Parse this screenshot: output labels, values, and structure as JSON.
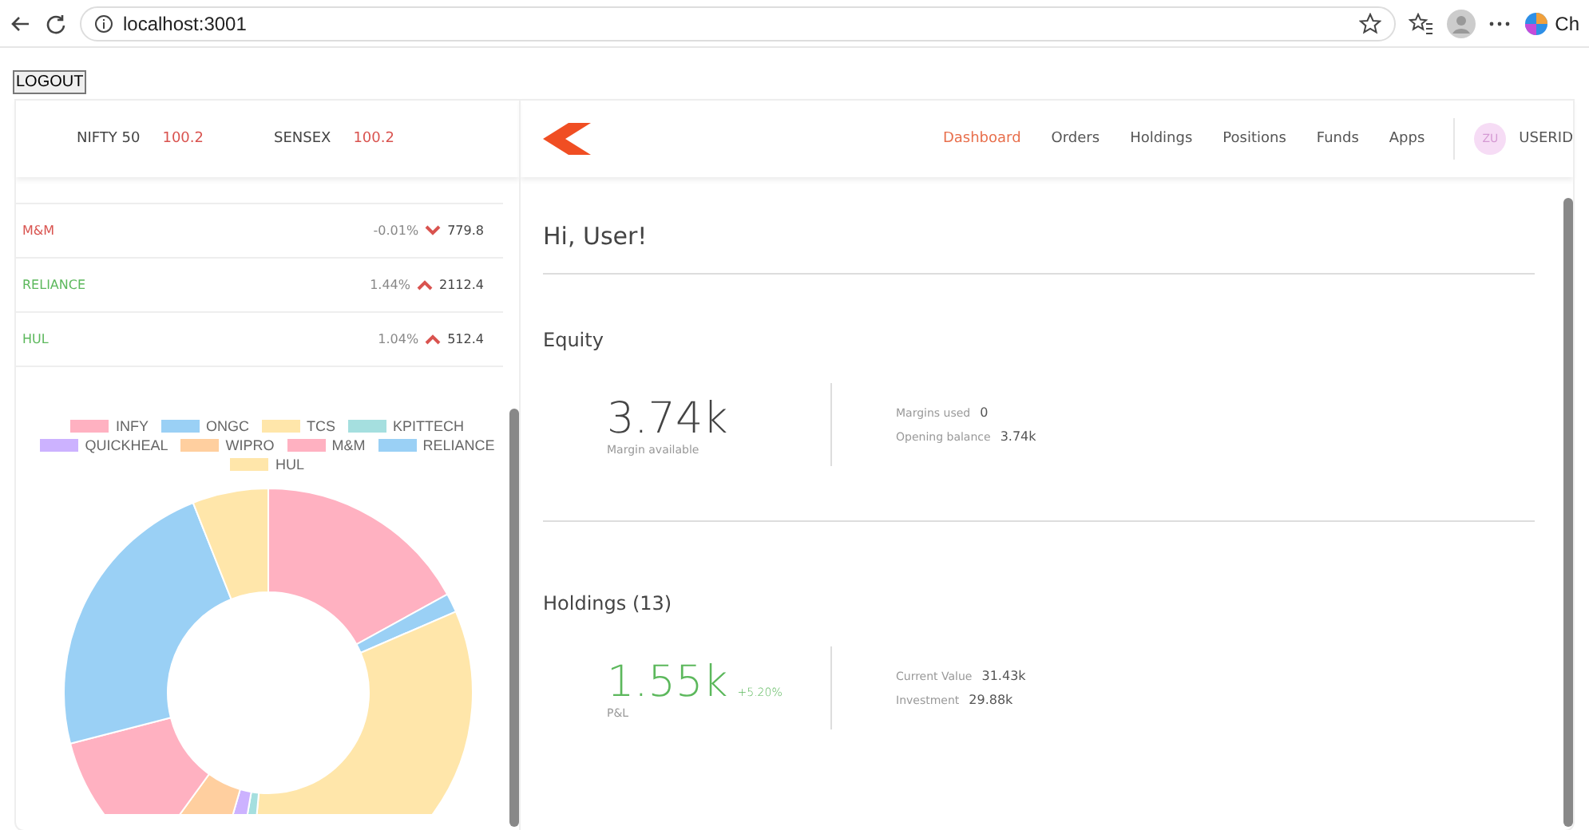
{
  "browser": {
    "address": "localhost:3001",
    "profile_label": "Ch"
  },
  "logout_button": "LOGOUT",
  "indices": [
    {
      "name": "NIFTY 50",
      "value": "100.2"
    },
    {
      "name": "SENSEX",
      "value": "100.2"
    }
  ],
  "nav": {
    "items": [
      {
        "label": "Dashboard",
        "selected": true
      },
      {
        "label": "Orders",
        "selected": false
      },
      {
        "label": "Holdings",
        "selected": false
      },
      {
        "label": "Positions",
        "selected": false
      },
      {
        "label": "Funds",
        "selected": false
      },
      {
        "label": "Apps",
        "selected": false
      }
    ],
    "avatar": "ZU",
    "user": "USERID"
  },
  "watchlist": [
    {
      "name": "M&M",
      "change": "-0.01%",
      "kind": "down",
      "price": "779.8"
    },
    {
      "name": "RELIANCE",
      "change": "1.44%",
      "kind": "up",
      "price": "2112.4"
    },
    {
      "name": "HUL",
      "change": "1.04%",
      "kind": "up",
      "price": "512.4"
    }
  ],
  "chart": {
    "legend": [
      {
        "label": "INFY",
        "color": "#ffb1c1"
      },
      {
        "label": "ONGC",
        "color": "#9ad0f5"
      },
      {
        "label": "TCS",
        "color": "#ffe6aa"
      },
      {
        "label": "KPITTECH",
        "color": "#a5dfdf"
      },
      {
        "label": "QUICKHEAL",
        "color": "#ccb2ff"
      },
      {
        "label": "WIPRO",
        "color": "#ffcf9f"
      },
      {
        "label": "M&M",
        "color": "#ffb1c1"
      },
      {
        "label": "RELIANCE",
        "color": "#9ad0f5"
      },
      {
        "label": "HUL",
        "color": "#ffe6aa"
      }
    ]
  },
  "greeting": "Hi, User!",
  "equity": {
    "title": "Equity",
    "value": "3.74k",
    "value_label": "Margin available",
    "stats": [
      {
        "label": "Margins used",
        "value": "0"
      },
      {
        "label": "Opening balance",
        "value": "3.74k"
      }
    ]
  },
  "holdings": {
    "title": "Holdings (13)",
    "value": "1.55k",
    "change": "+5.20%",
    "value_label": "P&L",
    "stats": [
      {
        "label": "Current Value",
        "value": "31.43k"
      },
      {
        "label": "Investment",
        "value": "29.88k"
      }
    ]
  }
}
